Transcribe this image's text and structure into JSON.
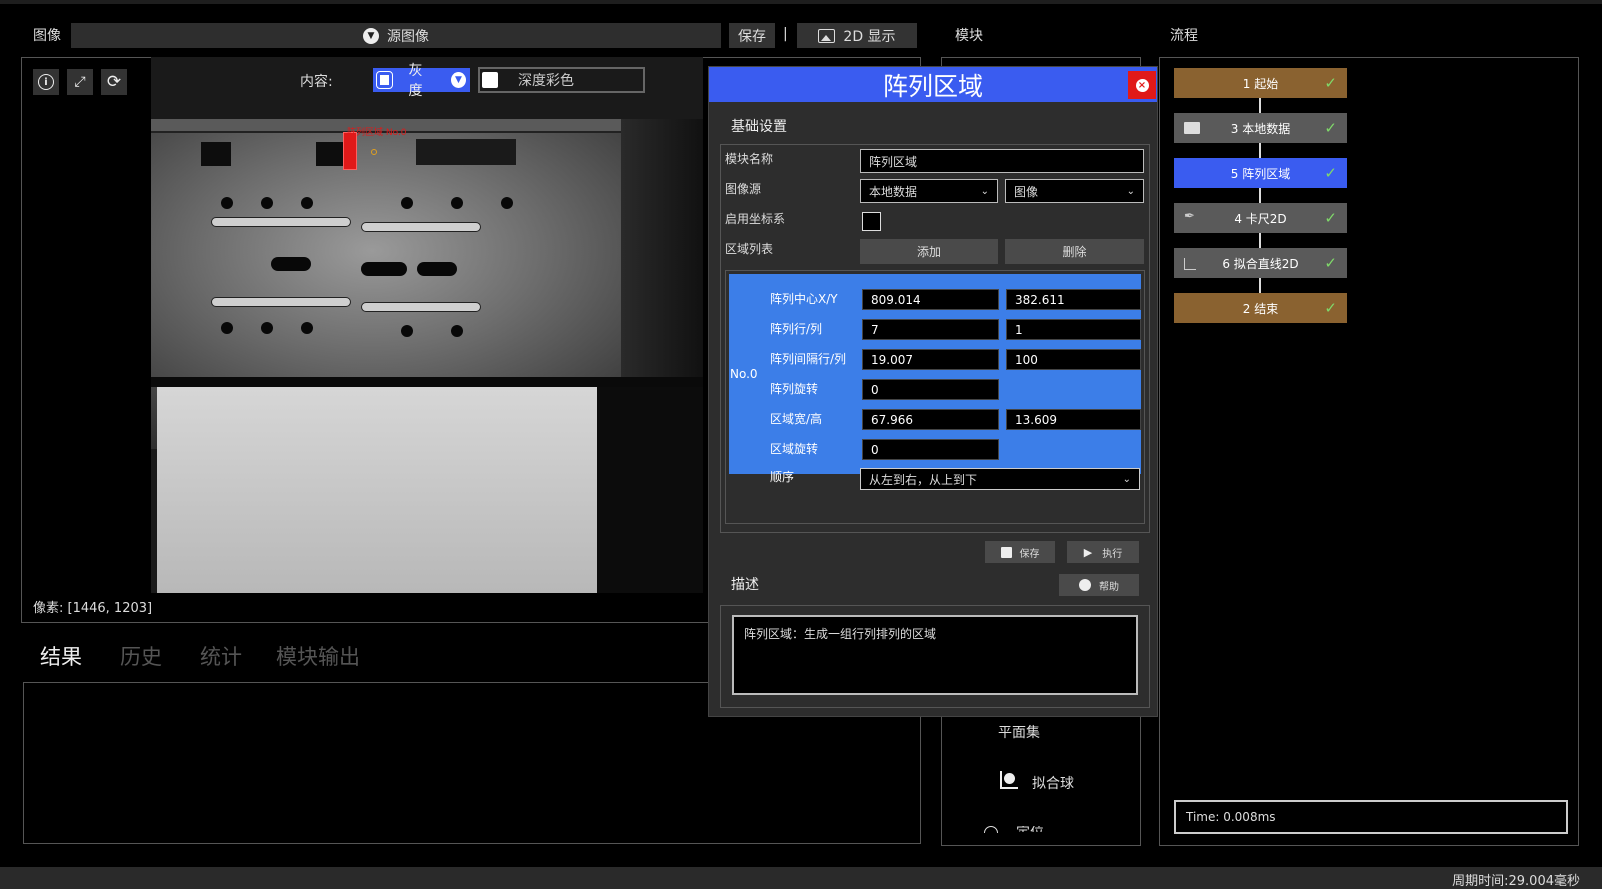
{
  "image_panel": {
    "title": "图像",
    "source_label": "源图像",
    "save_label": "保存",
    "separator": "|",
    "display_label": "2D 显示",
    "content_label": "内容:",
    "gray_label": "灰度",
    "depth_label": "深度彩色",
    "overlay_tag": "阵列区域 No.0",
    "pixel_info": "像素: [1446, 1203]"
  },
  "result_tabs": [
    "结果",
    "历史",
    "统计",
    "模块输出"
  ],
  "module_panel": {
    "title": "模块",
    "items": [
      {
        "label": "平面集",
        "icon": ""
      },
      {
        "label": "拟合球",
        "icon": "fit-sphere-icon"
      },
      {
        "label": "定位",
        "icon": "locate-icon"
      }
    ]
  },
  "flow_panel": {
    "title": "流程",
    "nodes": [
      {
        "label": "1 起始",
        "color": "#8a6230",
        "icon": ""
      },
      {
        "label": "3 本地数据",
        "color": "#5a5a5a",
        "icon": "folder-icon"
      },
      {
        "label": "5 阵列区域",
        "color": "#3a5cf0",
        "icon": ""
      },
      {
        "label": "4 卡尺2D",
        "color": "#5a5a5a",
        "icon": "caliper-icon"
      },
      {
        "label": "6 拟合直线2D",
        "color": "#5a5a5a",
        "icon": "fit-line-icon"
      },
      {
        "label": "2 结束",
        "color": "#8a6230",
        "icon": ""
      }
    ],
    "time": "Time: 0.008ms"
  },
  "status_bar": {
    "cycle_time": "周期时间:29.004毫秒"
  },
  "dialog": {
    "title": "阵列区域",
    "basic_section": "基础设置",
    "module_name_label": "模块名称",
    "module_name_value": "阵列区域",
    "image_source_label": "图像源",
    "image_source_1": "本地数据",
    "image_source_2": "图像",
    "enable_coord_label": "启用坐标系",
    "region_list_label": "区域列表",
    "add_label": "添加",
    "delete_label": "删除",
    "row_id": "No.0",
    "center_label": "阵列中心X/Y",
    "center_x": "809.014",
    "center_y": "382.611",
    "rowcol_label": "阵列行/列",
    "rows": "7",
    "cols": "1",
    "spacing_label": "阵列间隔行/列",
    "spacing_row": "19.007",
    "spacing_col": "100",
    "array_rot_label": "阵列旋转",
    "array_rot": "0",
    "region_wh_label": "区域宽/高",
    "region_w": "67.966",
    "region_h": "13.609",
    "region_rot_label": "区域旋转",
    "region_rot": "0",
    "order_label": "顺序",
    "order_value": "从左到右，从上到下",
    "save_label": "保存",
    "run_label": "执行",
    "desc_section": "描述",
    "help_label": "帮助",
    "desc_text": "阵列区域：生成一组行列排列的区域"
  },
  "colors": {
    "accent_blue": "#3a5cf0",
    "flow_brown": "#8a6230",
    "close_red": "#e01919",
    "check_green": "#7fd96a"
  }
}
